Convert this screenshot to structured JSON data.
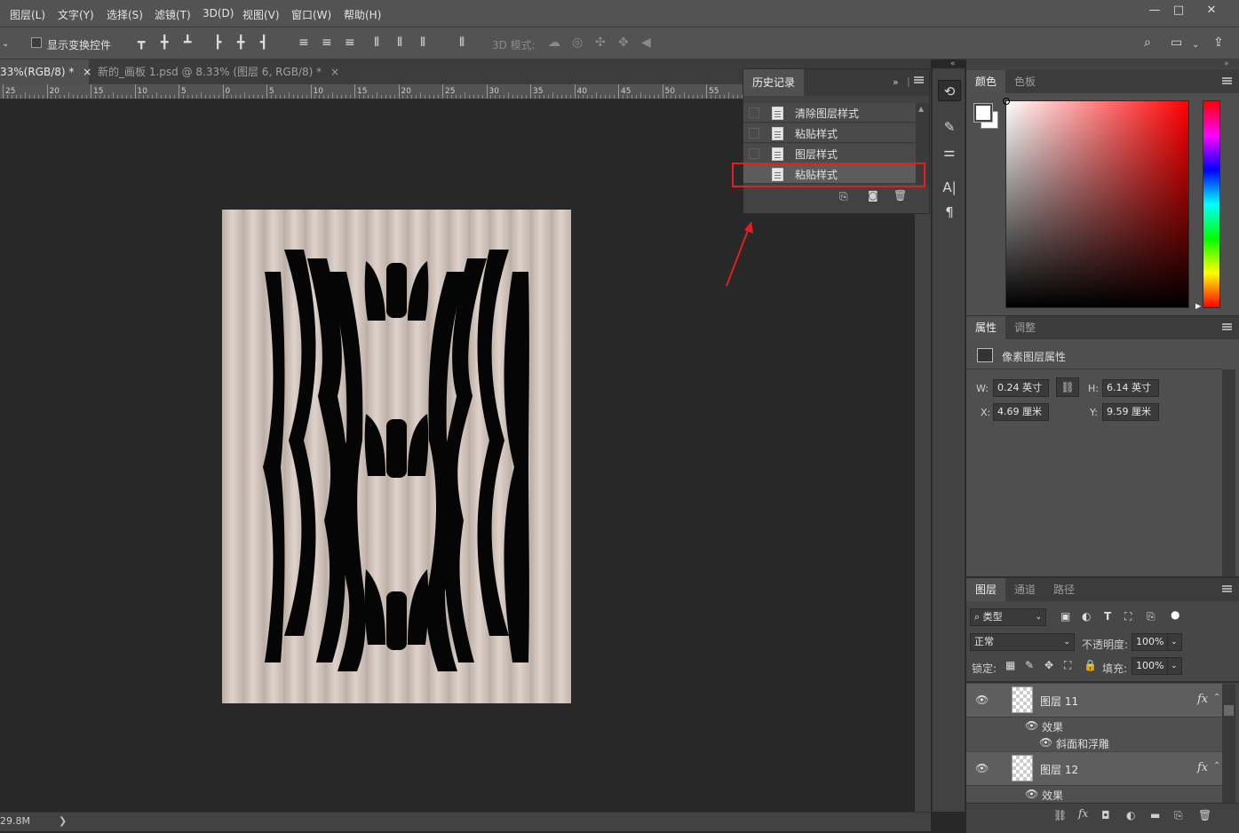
{
  "menubar": {
    "items": [
      "图层(L)",
      "文字(Y)",
      "选择(S)",
      "滤镜(T)",
      "3D(D)",
      "视图(V)",
      "窗口(W)",
      "帮助(H)"
    ],
    "window_controls": [
      "—",
      "□",
      "✕"
    ]
  },
  "options": {
    "show_transform_label": "显示变换控件",
    "mode_3d_label": "3D 模式:"
  },
  "tabs": [
    {
      "label": "33%(RGB/8) *",
      "close": "×",
      "active": true
    },
    {
      "label": "新的_画板 1.psd @ 8.33% (图层 6, RGB/8) *",
      "close": "×",
      "active": false
    }
  ],
  "ruler": {
    "ticks": [
      "25",
      "20",
      "15",
      "10",
      "5",
      "0",
      "5",
      "10",
      "15",
      "20",
      "25",
      "30",
      "35",
      "40",
      "45",
      "50",
      "55"
    ]
  },
  "status": {
    "doc_size": "29.8M",
    "arrow": "❯"
  },
  "history": {
    "tab": "历史记录",
    "items": [
      "清除图层样式",
      "粘贴样式",
      "图层样式",
      "粘贴样式"
    ],
    "selected_index": 3,
    "highlight_color": "#e02020"
  },
  "color_panel": {
    "tabs": [
      "颜色",
      "色板"
    ],
    "hue_color": "#ff0000"
  },
  "properties_panel": {
    "tabs": [
      "属性",
      "调整"
    ],
    "title": "像素图层属性",
    "w_label": "W:",
    "w_value": "0.24 英寸",
    "h_label": "H:",
    "h_value": "6.14 英寸",
    "x_label": "X:",
    "x_value": "4.69 厘米",
    "y_label": "Y:",
    "y_value": "9.59 厘米"
  },
  "layers_panel": {
    "tabs": [
      "图层",
      "通道",
      "路径"
    ],
    "filter_kind": "类型",
    "blend_mode": "正常",
    "opacity_label": "不透明度:",
    "opacity_value": "100%",
    "lock_label": "锁定:",
    "fill_label": "填充:",
    "fill_value": "100%",
    "layers": [
      {
        "name": "图层 11",
        "effects_label": "效果",
        "effect": "斜面和浮雕"
      },
      {
        "name": "图层 12",
        "effects_label": "效果"
      }
    ]
  },
  "icons": {
    "history_doc": "document-icon",
    "trash": "trash-icon",
    "camera": "camera-icon"
  }
}
